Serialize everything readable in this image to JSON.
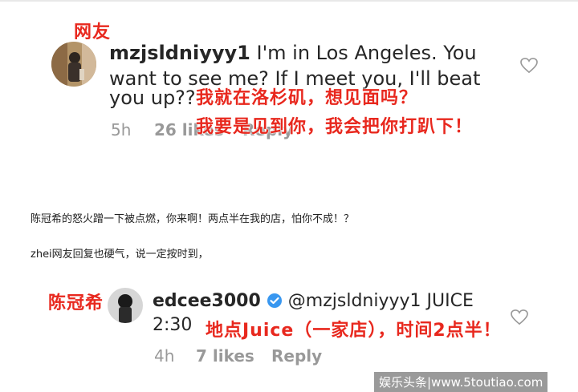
{
  "colors": {
    "accent_red": "#e8281e",
    "meta_gray": "#999999",
    "verified_blue": "#3897f0"
  },
  "comment1": {
    "tag": "网友",
    "username": "mzjsldniyyy1",
    "line1": "I'm in Los Angeles. You",
    "line2": "want to see me? If I meet you, I'll beat",
    "line3": "you up??",
    "translation1": "我就在洛杉矶，想见面吗？",
    "translation2": "我要是见到你，我会把你打趴下！",
    "time": "5h",
    "likes": "26 likes",
    "reply": "Reply",
    "heart_icon": "heart-outline-icon"
  },
  "article": {
    "para1": "陈冠希的怒火蹭一下被点燃，你来啊！两点半在我的店，怕你不成！？",
    "para2": "zhei网友回复也硬气，说一定按时到，"
  },
  "comment2": {
    "tag": "陈冠希",
    "username": "edcee3000",
    "mention": "@mzjsldniyyy1",
    "text_end": "JUICE",
    "time_text": "2:30",
    "translation": "地点Juice（一家店），时间2点半！",
    "time": "4h",
    "likes": "7 likes",
    "reply": "Reply",
    "verified_icon": "verified-badge-icon",
    "heart_icon": "heart-outline-icon"
  },
  "watermark": "娱乐头条|www.5toutiao.com"
}
